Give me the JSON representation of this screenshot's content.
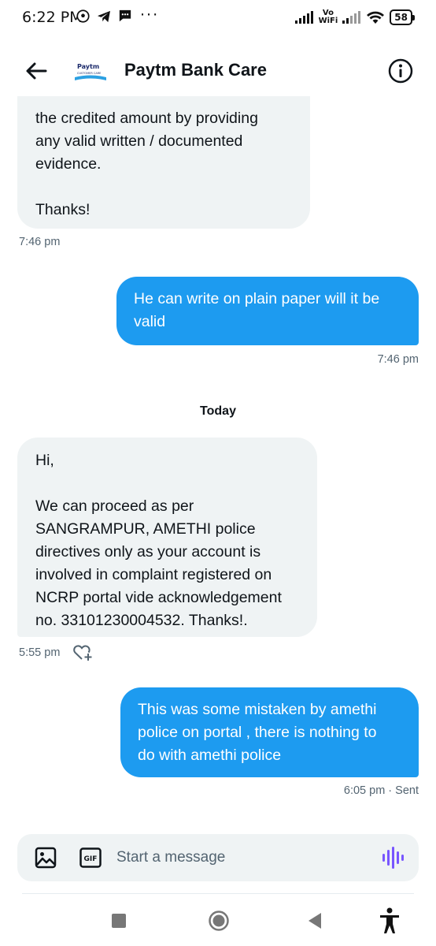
{
  "status_bar": {
    "time": "6:22 PM",
    "vo": "Vo",
    "wifi_label": "WiFi",
    "battery": "58",
    "more": "···"
  },
  "header": {
    "title": "Paytm Bank Care",
    "logo_text": "Paytm",
    "logo_sub": "CUSTOMER CARE"
  },
  "messages": [
    {
      "direction": "received",
      "text": "the credited amount by providing\nany valid written / documented\nevidence.\n\nThanks!",
      "time": "7:46 pm"
    },
    {
      "direction": "sent",
      "text": "He can write on plain paper will it be\nvalid",
      "time": "7:46 pm"
    },
    {
      "direction": "received",
      "text": "Hi,\n\nWe can proceed as per\nSANGRAMPUR, AMETHI police\ndirectives only as your account is\ninvolved in complaint registered on\nNCRP portal vide acknowledgement\nno. 33101230004532. Thanks!.",
      "time": "5:55 pm"
    },
    {
      "direction": "sent",
      "text": "This was some mistaken by amethi\npolice on portal , there is nothing to\ndo with amethi police",
      "time": "6:05 pm · Sent"
    }
  ],
  "divider": "Today",
  "composer": {
    "placeholder": "Start a message",
    "gif_label": "GIF"
  },
  "colors": {
    "accent": "#1d9bf0",
    "received_bg": "#eff3f4",
    "muted_text": "#536471"
  }
}
